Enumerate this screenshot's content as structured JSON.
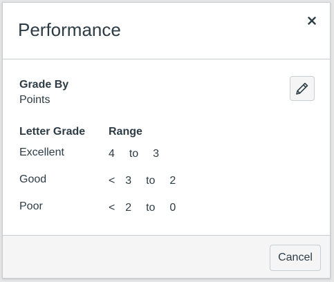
{
  "dialog": {
    "title": "Performance",
    "close_icon": "close-icon"
  },
  "grade_by": {
    "label": "Grade By",
    "value": "Points",
    "edit_icon": "pencil-icon"
  },
  "table": {
    "headers": {
      "letter_grade": "Letter Grade",
      "range": "Range"
    },
    "rows": [
      {
        "name": "Excellent",
        "prefix": "",
        "from": "4",
        "to_word": "to",
        "to": "3"
      },
      {
        "name": "Good",
        "prefix": "<",
        "from": "3",
        "to_word": "to",
        "to": "2"
      },
      {
        "name": "Poor",
        "prefix": "<",
        "from": "2",
        "to_word": "to",
        "to": "0"
      }
    ]
  },
  "footer": {
    "cancel_label": "Cancel"
  }
}
